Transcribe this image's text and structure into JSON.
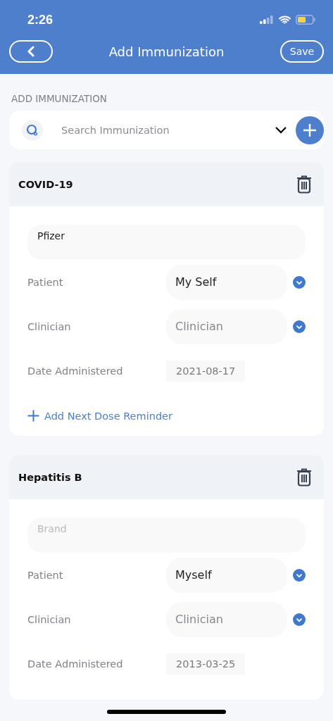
{
  "status_bar": {
    "time": "2:26"
  },
  "nav": {
    "title": "Add Immunization",
    "save": "Save"
  },
  "section_label": "ADD IMMUNIZATION",
  "search": {
    "placeholder": "Search Immunization"
  },
  "cards": [
    {
      "title": "COVID-19",
      "brand": {
        "value": "Pfizer"
      },
      "patient_label": "Patient",
      "patient": {
        "value": "My Self"
      },
      "clinician_label": "Clinician",
      "clinician": {
        "placeholder": "Clinician"
      },
      "date_label": "Date Administered",
      "date": "2021-08-17",
      "reminder": "Add Next Dose Reminder"
    },
    {
      "title": "Hepatitis B",
      "brand": {
        "placeholder": "Brand"
      },
      "patient_label": "Patient",
      "patient": {
        "value": "Myself"
      },
      "clinician_label": "Clinician",
      "clinician": {
        "placeholder": "Clinician"
      },
      "date_label": "Date Administered",
      "date": "2013-03-25"
    }
  ]
}
